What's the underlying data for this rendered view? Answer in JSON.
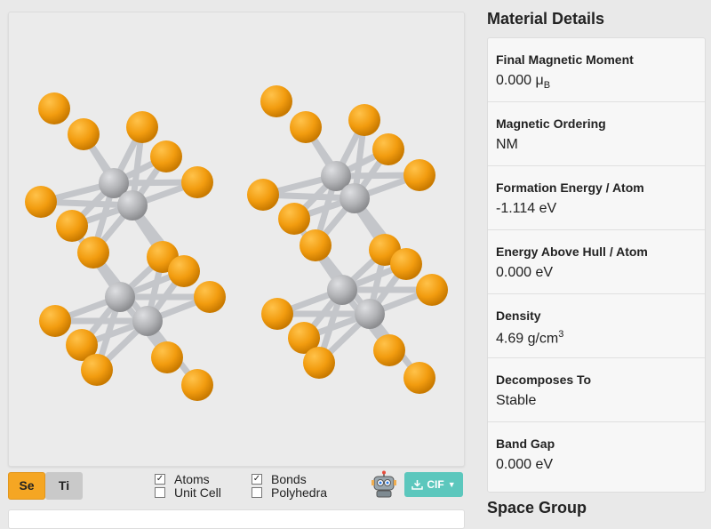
{
  "viewer": {
    "atom_colors": {
      "Se": "#f29c0f",
      "Ti": "#b2b3b6"
    },
    "bond_color": "#c4c6ca"
  },
  "controls": {
    "elements": [
      {
        "symbol": "Se",
        "active": true,
        "color": "#f5a623"
      },
      {
        "symbol": "Ti",
        "active": false,
        "color": "#c9c9c9"
      }
    ],
    "options": [
      {
        "label": "Atoms",
        "checked": true
      },
      {
        "label": "Unit Cell",
        "checked": false
      },
      {
        "label": "Bonds",
        "checked": true
      },
      {
        "label": "Polyhedra",
        "checked": false
      }
    ],
    "robot_icon": "robot-icon",
    "cif_button": {
      "label": "CIF",
      "icon": "download-icon",
      "color": "#5cc7bd"
    }
  },
  "sidebar": {
    "material_title": "Material Details",
    "details": [
      {
        "label": "Final Magnetic Moment",
        "value": "0.000 μ",
        "sub": "B"
      },
      {
        "label": "Magnetic Ordering",
        "value": "NM"
      },
      {
        "label": "Formation Energy / Atom",
        "value": "-1.114 eV"
      },
      {
        "label": "Energy Above Hull / Atom",
        "value": "0.000 eV"
      },
      {
        "label": "Density",
        "value": "4.69 g/cm",
        "sup": "3"
      },
      {
        "label": "Decomposes To",
        "value": "Stable"
      },
      {
        "label": "Band Gap",
        "value": "0.000 eV"
      }
    ],
    "space_group_title": "Space Group"
  }
}
